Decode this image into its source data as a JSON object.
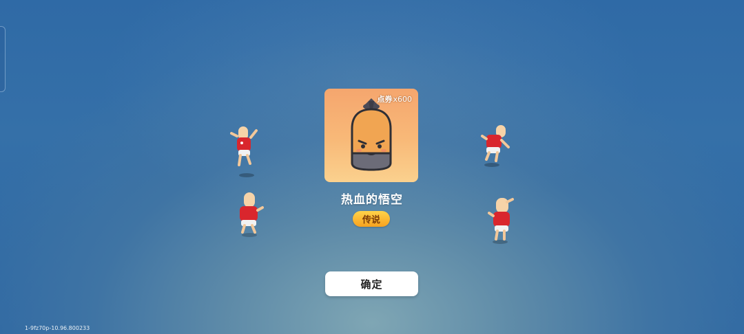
{
  "reward": {
    "price_currency": "点券",
    "price_amount": "x600",
    "item_name": "热血的悟空",
    "rarity": "传说"
  },
  "actions": {
    "confirm_label": "确定"
  },
  "footer": {
    "version": "1-9fz70p-10.96.800233"
  },
  "colors": {
    "background": "#3570a8",
    "card_top": "#f5a66e",
    "card_bottom": "#fbd18e",
    "rarity_badge": "#f8a21f",
    "confirm_button": "#ffffff"
  },
  "icons": [
    "bag-character-icon",
    "dancing-character"
  ]
}
